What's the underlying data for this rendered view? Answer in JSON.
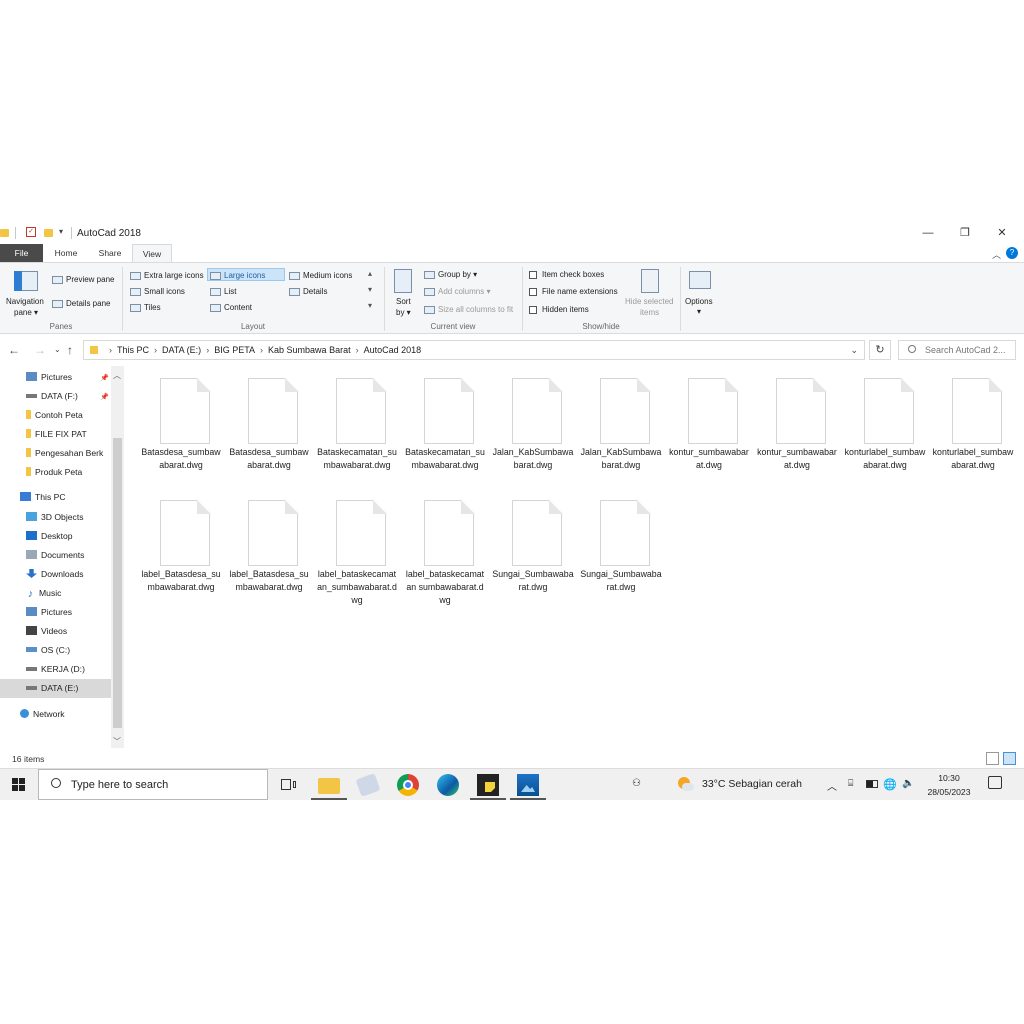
{
  "window": {
    "title": "AutoCad 2018"
  },
  "tabs": [
    "File",
    "Home",
    "Share",
    "View"
  ],
  "ribbon": {
    "panes": {
      "navigation_pane": "Navigation",
      "navigation_pane_2": "pane",
      "preview_pane": "Preview pane",
      "details_pane": "Details pane",
      "group_label": "Panes"
    },
    "layout": {
      "items": [
        "Extra large icons",
        "Large icons",
        "Medium icons",
        "Small icons",
        "List",
        "Details",
        "Tiles",
        "Content"
      ],
      "group_label": "Layout"
    },
    "current_view": {
      "sort_by": "Sort",
      "sort_by_2": "by",
      "group_by": "Group by",
      "add_columns": "Add columns",
      "size_all_columns": "Size all columns to fit",
      "group_label": "Current view"
    },
    "show_hide": {
      "item_check_boxes": "Item check boxes",
      "file_name_extensions": "File name extensions",
      "hidden_items": "Hidden items",
      "hide_selected": "Hide selected",
      "hide_selected_2": "items",
      "options": "Options",
      "group_label": "Show/hide"
    }
  },
  "address": {
    "crumbs": [
      "This PC",
      "DATA (E:)",
      "BIG PETA",
      "Kab Sumbawa Barat",
      "AutoCad 2018"
    ],
    "search_placeholder": "Search AutoCad 2..."
  },
  "nav": {
    "quick": [
      "Pictures",
      "DATA (F:)",
      "Contoh Peta",
      "FILE FIX PAT",
      "Pengesahan Berk",
      "Produk Peta"
    ],
    "this_pc": "This PC",
    "pc_items": [
      "3D Objects",
      "Desktop",
      "Documents",
      "Downloads",
      "Music",
      "Pictures",
      "Videos",
      "OS (C:)",
      "KERJA (D:)",
      "DATA (E:)"
    ],
    "network": "Network"
  },
  "files": [
    "Batasdesa_sumbawabarat.dwg",
    "Batasdesa_sumbawabarat.dwg",
    "Bataskecamatan_sumbawabarat.dwg",
    "Bataskecamatan_sumbawabarat.dwg",
    "Jalan_KabSumbawabarat.dwg",
    "Jalan_KabSumbawabarat.dwg",
    "kontur_sumbawabarat.dwg",
    "kontur_sumbawabarat.dwg",
    "konturlabel_sumbawabarat.dwg",
    "konturlabel_sumbawabarat.dwg",
    "label_Batasdesa_sumbawabarat.dwg",
    "label_Batasdesa_sumbawabarat.dwg",
    "label_bataskecamatan_sumbawabarat.dwg",
    "label_bataskecamatan sumbawabarat.dwg",
    "Sungai_Sumbawabarat.dwg",
    "Sungai_Sumbawabarat.dwg"
  ],
  "status": {
    "count": "16 items"
  },
  "taskbar": {
    "search_placeholder": "Type here to search",
    "weather": "33°C  Sebagian cerah",
    "time": "10:30",
    "date": "28/05/2023"
  },
  "colors": {
    "accent": "#0078d7",
    "folder": "#f3c545",
    "file_tab": "#4a4a4a",
    "selection": "#cce4f7"
  }
}
